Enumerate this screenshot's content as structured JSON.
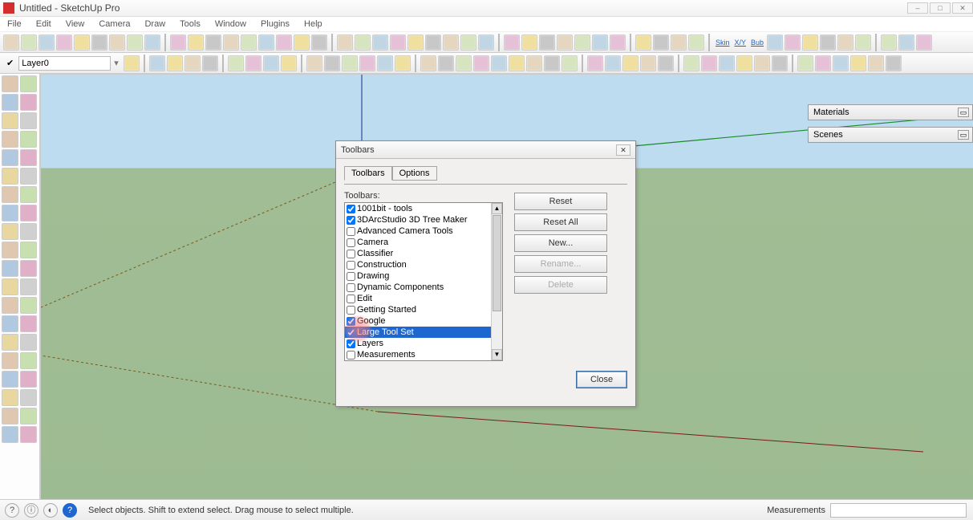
{
  "title": "Untitled - SketchUp Pro",
  "menu": [
    "File",
    "Edit",
    "View",
    "Camera",
    "Draw",
    "Tools",
    "Window",
    "Plugins",
    "Help"
  ],
  "layer": {
    "value": "Layer0"
  },
  "skin_labels": [
    "Skin",
    "X/Y",
    "Bub"
  ],
  "panels": {
    "materials": "Materials",
    "scenes": "Scenes"
  },
  "status": {
    "hint": "Select objects. Shift to extend select. Drag mouse to select multiple.",
    "measurements_label": "Measurements",
    "measurements_value": ""
  },
  "dialog": {
    "title": "Toolbars",
    "tabs": [
      "Toolbars",
      "Options"
    ],
    "list_label": "Toolbars:",
    "items": [
      {
        "label": "1001bit - tools",
        "checked": true
      },
      {
        "label": "3DArcStudio 3D Tree Maker",
        "checked": true
      },
      {
        "label": "Advanced Camera Tools",
        "checked": false
      },
      {
        "label": "Camera",
        "checked": false
      },
      {
        "label": "Classifier",
        "checked": false
      },
      {
        "label": "Construction",
        "checked": false
      },
      {
        "label": "Drawing",
        "checked": false
      },
      {
        "label": "Dynamic Components",
        "checked": false
      },
      {
        "label": "Edit",
        "checked": false
      },
      {
        "label": "Getting Started",
        "checked": false
      },
      {
        "label": "Google",
        "checked": true
      },
      {
        "label": "Large Tool Set",
        "checked": true,
        "selected": true
      },
      {
        "label": "Layers",
        "checked": true
      },
      {
        "label": "Measurements",
        "checked": false
      }
    ],
    "buttons": {
      "reset": "Reset",
      "reset_all": "Reset All",
      "new": "New...",
      "rename": "Rename...",
      "delete": "Delete",
      "close": "Close"
    }
  }
}
